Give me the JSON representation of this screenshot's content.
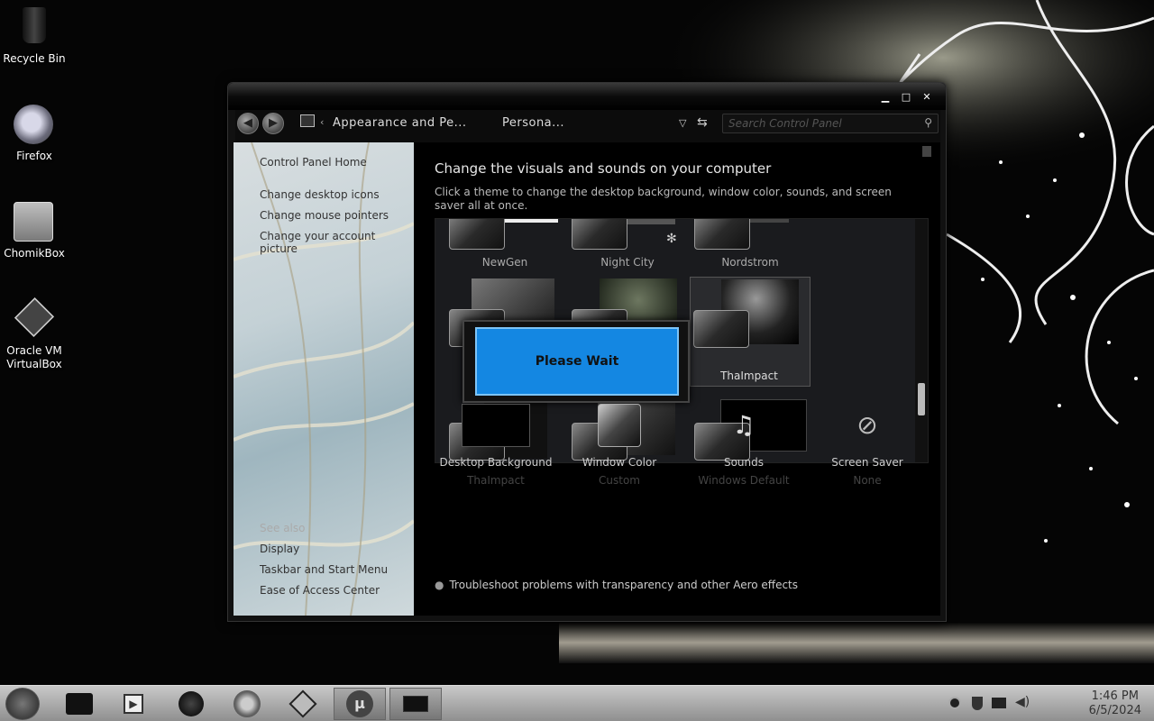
{
  "desktop": {
    "icons": [
      {
        "label": "Recycle Bin",
        "icon": "recycle-bin-icon"
      },
      {
        "label": "Firefox",
        "icon": "firefox-icon"
      },
      {
        "label": "ChomikBox",
        "icon": "chomikbox-icon"
      },
      {
        "label": "Oracle VM VirtualBox",
        "icon": "virtualbox-icon"
      }
    ]
  },
  "window": {
    "controls": {
      "minimize": "▁",
      "maximize": "□",
      "close": "✕"
    },
    "address": {
      "crumb1": "Appearance and Pe...",
      "crumb2": "Persona...",
      "search_placeholder": "Search Control Panel"
    },
    "sidebar": {
      "home": "Control Panel Home",
      "links": [
        "Change desktop icons",
        "Change mouse pointers",
        "Change your account picture"
      ],
      "see_also": "See also",
      "see_also_links": [
        "Display",
        "Taskbar and Start Menu",
        "Ease of Access Center"
      ]
    },
    "main": {
      "heading": "Change the visuals and sounds on your computer",
      "subtext": "Click a theme to change the desktop background, window color, sounds, and screen saver all at once.",
      "themes_row1": [
        "NewGen",
        "Night City",
        "Nordstrom"
      ],
      "theme_selected": "ThaImpact",
      "dialog": "Please Wait",
      "tiles": [
        {
          "title": "Desktop Background",
          "value": "ThaImpact"
        },
        {
          "title": "Window Color",
          "value": "Custom"
        },
        {
          "title": "Sounds",
          "value": "Windows Default"
        },
        {
          "title": "Screen Saver",
          "value": "None"
        }
      ],
      "troubleshoot": "Troubleshoot problems with transparency and other Aero effects"
    }
  },
  "taskbar": {
    "time": "1:46 PM",
    "date": "6/5/2024"
  },
  "colors": {
    "dialog_blue": "#1487e2",
    "background": "#050505"
  }
}
